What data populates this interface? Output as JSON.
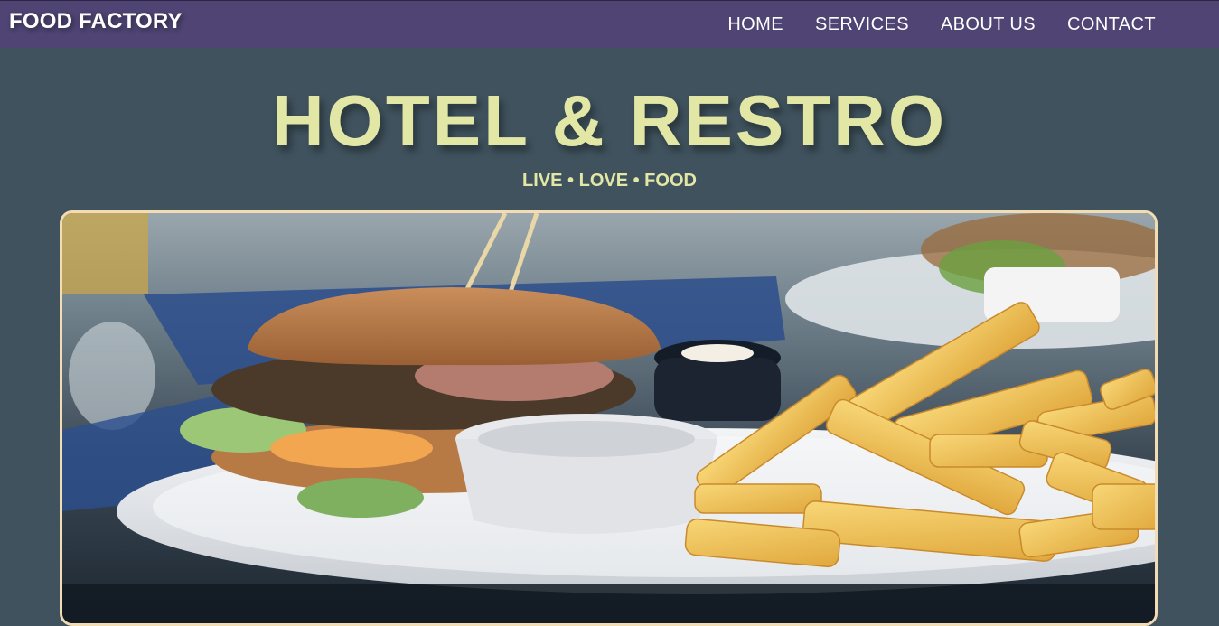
{
  "nav": {
    "brand": "FOOD FACTORY",
    "links": [
      "HOME",
      "SERVICES",
      "ABOUT US",
      "CONTACT"
    ]
  },
  "hero": {
    "title": "HOTEL & RESTRO",
    "tagline": "LIVE • LOVE • FOOD"
  },
  "colors": {
    "navbar": "#4f4473",
    "background": "#3f525d",
    "accent_text": "#e3e7a6",
    "frame_border": "#f2dcb3"
  }
}
